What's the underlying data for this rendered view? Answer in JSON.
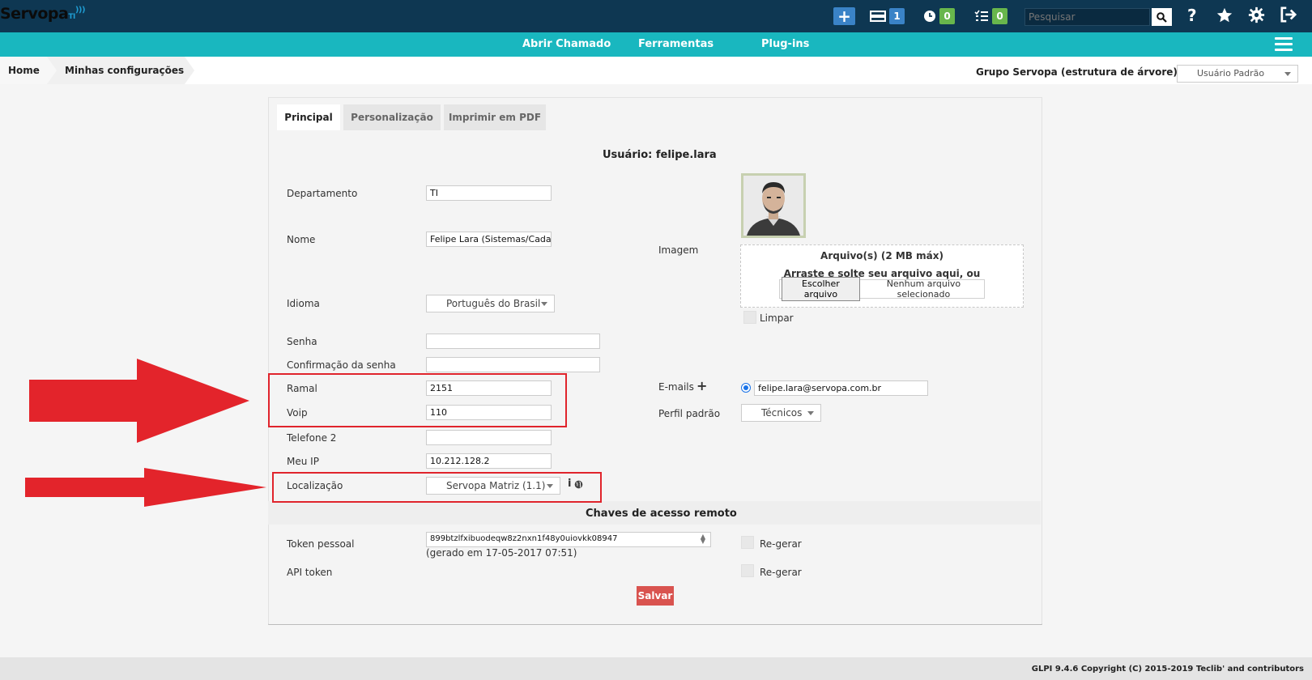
{
  "topbar": {
    "logo_text": "Servopa",
    "logo_suffix": "TI",
    "plus_label": "+",
    "tickets_count": "1",
    "clock_count": "0",
    "tasks_count": "0",
    "search_placeholder": "Pesquisar",
    "help_label": "?"
  },
  "menu": {
    "items": [
      "Abrir Chamado",
      "Ferramentas",
      "Plug-ins"
    ]
  },
  "breadcrumb": {
    "home": "Home",
    "current": "Minhas configurações",
    "entity": "Grupo Servopa (estrutura de árvore)",
    "profile": "Usuário Padrão"
  },
  "tabs": [
    "Principal",
    "Personalização",
    "Imprimir em PDF"
  ],
  "form": {
    "title": "Usuário: felipe.lara",
    "labels": {
      "departamento": "Departamento",
      "nome": "Nome",
      "idioma": "Idioma",
      "senha": "Senha",
      "confirmacao": "Confirmação da senha",
      "ramal": "Ramal",
      "voip": "Voip",
      "telefone2": "Telefone 2",
      "meu_ip": "Meu IP",
      "localizacao": "Localização",
      "imagem": "Imagem",
      "emails": "E-mails",
      "perfil": "Perfil padrão",
      "limpar": "Limpar"
    },
    "values": {
      "departamento": "TI",
      "nome": "Felipe Lara (Sistemas/Cadast",
      "idioma": "Português do Brasil",
      "senha": "",
      "confirmacao": "",
      "ramal": "2151",
      "voip": "110",
      "telefone2": "",
      "meu_ip": "10.212.128.2",
      "localizacao": "Servopa Matriz (1.1)",
      "email": "felipe.lara@servopa.com.br",
      "perfil": "Técnicos"
    },
    "upload": {
      "title": "Arquivo(s) (2 MB máx)",
      "hint": "Arraste e solte seu arquivo aqui, ou",
      "button": "Escolher arquivo",
      "status": "Nenhum arquivo selecionado"
    },
    "remote": {
      "title": "Chaves de acesso remoto",
      "token_label": "Token pessoal",
      "token_value": "899btzlfxibuodeqw8z2nxn1f48y0uiovkk08947",
      "token_date": "(gerado em 17-05-2017 07:51)",
      "api_label": "API token",
      "regen": "Re-gerar"
    },
    "save": "Salvar"
  },
  "footer": "GLPI 9.4.6 Copyright (C) 2015-2019 Teclib' and contributors",
  "colors": {
    "topbar": "#0e3752",
    "menubar": "#19b7bf",
    "save": "#d9534f",
    "annotation": "#e0242c"
  }
}
